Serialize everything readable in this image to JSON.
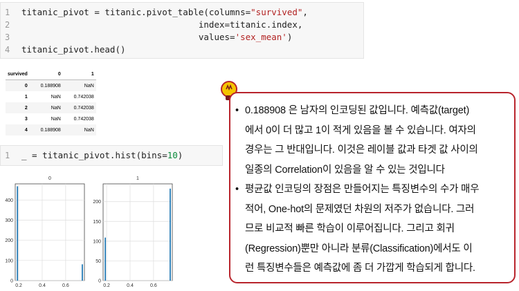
{
  "code_cell_1": {
    "line_numbers": [
      "1",
      "2",
      "3",
      "4"
    ],
    "lines": [
      {
        "a": "titanic_pivot = titanic.pivot_table(columns=",
        "s": "\"survived\"",
        "b": ","
      },
      {
        "a": "                                  index=titanic.index,",
        "s": "",
        "b": ""
      },
      {
        "a": "                                  values=",
        "s": "'sex_mean'",
        "b": ")"
      },
      {
        "a": "titanic_pivot.head()",
        "s": "",
        "b": ""
      }
    ]
  },
  "dataframe": {
    "columns_label": "survived",
    "columns": [
      "0",
      "1"
    ],
    "rows": [
      {
        "index": "0",
        "c0": "0.188908",
        "c1": "NaN"
      },
      {
        "index": "1",
        "c0": "NaN",
        "c1": "0.742038"
      },
      {
        "index": "2",
        "c0": "NaN",
        "c1": "0.742038"
      },
      {
        "index": "3",
        "c0": "NaN",
        "c1": "0.742038"
      },
      {
        "index": "4",
        "c0": "0.188908",
        "c1": "NaN"
      }
    ]
  },
  "code_cell_2": {
    "line_number": "1",
    "code_a": "_ = titanic_pivot.hist(bins=",
    "code_num": "10",
    "code_b": ")"
  },
  "colors": {
    "bar": "#1f77b4",
    "callout_border": "#b8242c"
  },
  "chart_data": [
    {
      "type": "bar",
      "title": "0",
      "x_ticks": [
        "0.2",
        "0.4",
        "0.6"
      ],
      "xlim": [
        0.17,
        0.76
      ],
      "y_ticks": [
        "0",
        "100",
        "200",
        "300",
        "400"
      ],
      "ylim": [
        0,
        480
      ],
      "grid": true,
      "bins": [
        {
          "x": 0.188908,
          "value": 468
        },
        {
          "x": 0.742038,
          "value": 81
        }
      ]
    },
    {
      "type": "bar",
      "title": "1",
      "x_ticks": [
        "0.2",
        "0.4",
        "0.6"
      ],
      "xlim": [
        0.17,
        0.76
      ],
      "y_ticks": [
        "0",
        "50",
        "100",
        "150",
        "200"
      ],
      "ylim": [
        0,
        245
      ],
      "grid": true,
      "bins": [
        {
          "x": 0.188908,
          "value": 109
        },
        {
          "x": 0.742038,
          "value": 233
        }
      ]
    }
  ],
  "callout": {
    "icon": "lightbulb-icon",
    "bullet": "•",
    "bullets": [
      [
        "0.188908 은 남자의 인코딩된 값입니다. 예측값(target)",
        "에서 0이 더 많고 1이 적게 있음을 볼 수 있습니다. 여자의",
        "경우는 그 반대입니다. 이것은 레이블 값과 타겟 값 사이의",
        "일종의 Correlation이 있음을 알 수 있는 것입니다"
      ],
      [
        "평균값 인코딩의 장점은 만들어지는 특징변수의 수가 매우",
        "적어, One-hot의 문제였던 차원의 저주가 없습니다. 그러",
        "므로 비교적 빠른 학습이 이루어집니다. 그리고 회귀",
        "(Regression)뿐만 아니라 분류(Classification)에서도 이",
        "런 특징변수들은 예측값에 좀 더 가깝게 학습되게 합니다."
      ]
    ]
  }
}
